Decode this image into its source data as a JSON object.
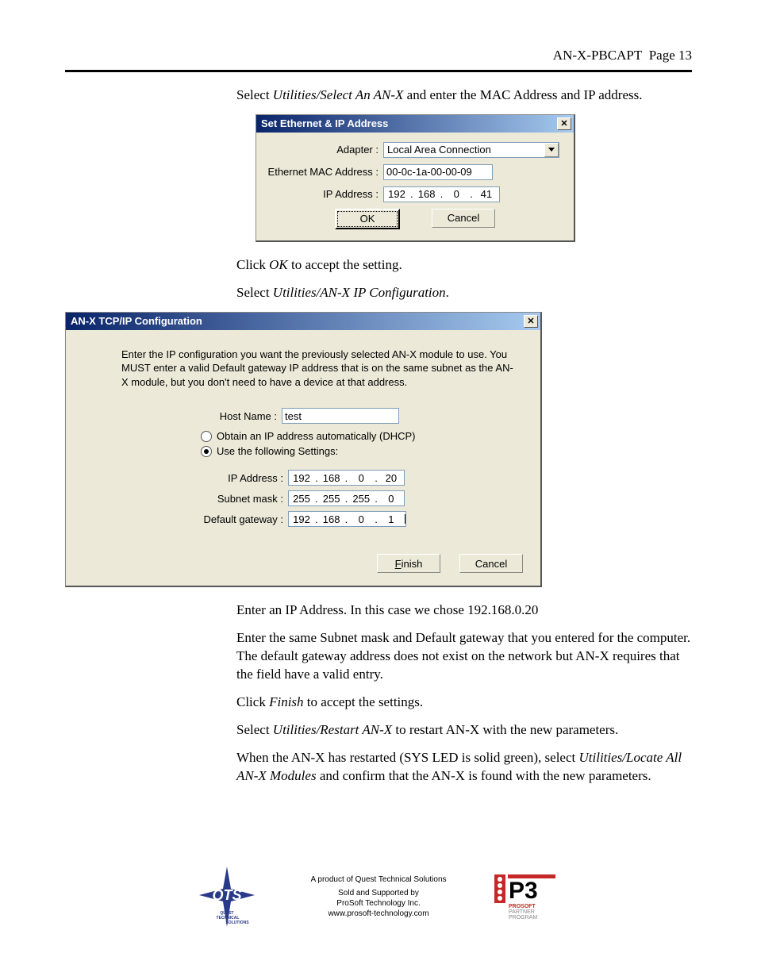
{
  "header": {
    "doc_title": "AN-X-PBCAPT",
    "page_label": "Page",
    "page_num": "13"
  },
  "para1_a": "Select ",
  "para1_b": "Utilities/Select An AN-X",
  "para1_c": " and enter the MAC Address and IP address.",
  "dlg1": {
    "title": "Set Ethernet & IP Address",
    "adapter_label": "Adapter :",
    "adapter_value": "Local Area Connection",
    "mac_label": "Ethernet MAC Address :",
    "mac_value": "00-0c-1a-00-00-09",
    "ip_label": "IP Address :",
    "ip_octets": [
      "192",
      "168",
      "0",
      "41"
    ],
    "ok": "OK",
    "cancel": "Cancel"
  },
  "para2_a": "Click ",
  "para2_b": "OK",
  "para2_c": " to accept the setting.",
  "para3_a": "Select ",
  "para3_b": "Utilities/AN-X IP Configuration",
  "para3_c": ".",
  "dlg2": {
    "title": "AN-X TCP/IP Configuration",
    "instr": "Enter the IP configuration you want the previously selected AN-X module to use. You MUST enter a valid Default gateway IP address that is on the same subnet as the AN-X module, but you don't need to have a device at that address.",
    "host_label": "Host Name :",
    "host_value": "test",
    "radio_dhcp": "Obtain an IP address automatically (DHCP)",
    "radio_static": "Use the following Settings:",
    "ip_label": "IP Address :",
    "ip_octets": [
      "192",
      "168",
      "0",
      "20"
    ],
    "mask_label": "Subnet mask :",
    "mask_octets": [
      "255",
      "255",
      "255",
      "0"
    ],
    "gw_label": "Default gateway :",
    "gw_octets": [
      "192",
      "168",
      "0",
      "1"
    ],
    "finish": "Finish",
    "cancel": "Cancel"
  },
  "para4": "Enter an IP Address.  In this case we chose 192.168.0.20",
  "para5": "Enter the same Subnet mask and Default gateway that you entered for the computer.  The default gateway address does not exist on the network but AN-X requires that the field have a valid entry.",
  "para6_a": "Click ",
  "para6_b": "Finish",
  "para6_c": " to accept the settings.",
  "para7_a": "Select ",
  "para7_b": "Utilities/Restart AN-X",
  "para7_c": " to restart AN-X with the new parameters.",
  "para8_a": "When the AN-X has restarted (SYS LED is solid green), select ",
  "para8_b": "Utilities/Locate All AN-X Modules",
  "para8_c": " and confirm that the AN-X is found with the new parameters.",
  "footer": {
    "line1": "A product of Quest Technical Solutions",
    "line2": "Sold and Supported by",
    "line3": "ProSoft Technology Inc.",
    "line4": "www.prosoft-technology.com"
  }
}
